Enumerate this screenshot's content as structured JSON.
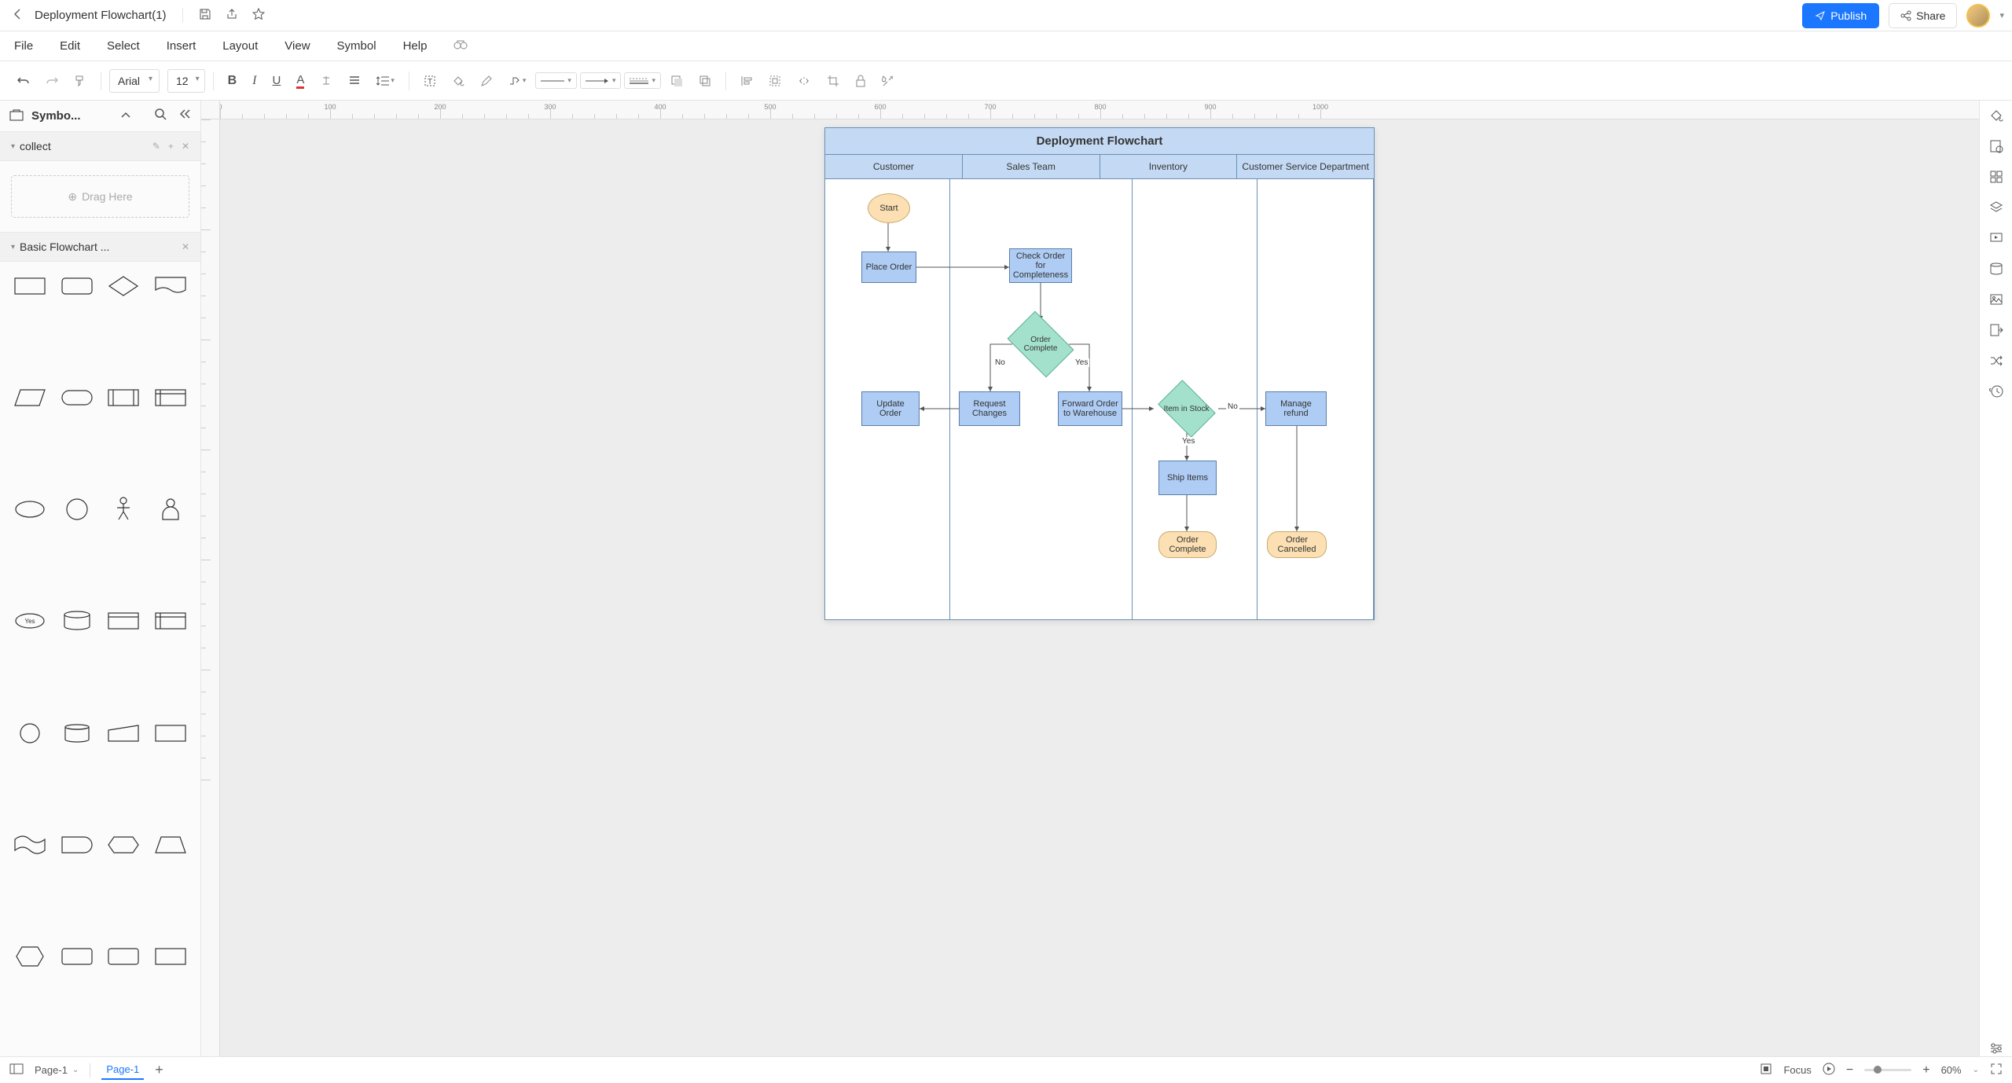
{
  "document": {
    "title": "Deployment Flowchart(1)"
  },
  "topbar": {
    "publish": "Publish",
    "share": "Share"
  },
  "menus": {
    "file": "File",
    "edit": "Edit",
    "select": "Select",
    "insert": "Insert",
    "layout": "Layout",
    "view": "View",
    "symbol": "Symbol",
    "help": "Help"
  },
  "toolbar": {
    "font": "Arial",
    "size": "12"
  },
  "sidebar": {
    "title": "Symbo...",
    "collect": {
      "label": "collect",
      "drag": "Drag Here"
    },
    "flowchart_section": "Basic Flowchart ..."
  },
  "swimlane": {
    "title": "Deployment Flowchart",
    "columns": [
      "Customer",
      "Sales Team",
      "Inventory",
      "Customer Service Department"
    ]
  },
  "nodes": {
    "start": "Start",
    "place_order": "Place Order",
    "check_order": "Check Order for Completeness",
    "order_complete_d": "Order Complete",
    "no": "No",
    "yes": "Yes",
    "request_changes": "Request Changes",
    "update_order": "Update Order",
    "forward": "Forward Order to Warehouse",
    "item_stock": "Item in Stock",
    "no2": "No",
    "yes2": "Yes",
    "manage_refund": "Manage refund",
    "ship_items": "Ship Items",
    "order_complete_end": "Order Complete",
    "order_cancelled": "Order Cancelled"
  },
  "status": {
    "page_dd": "Page-1",
    "page_tab": "Page-1",
    "focus": "Focus",
    "zoom": "60%"
  },
  "shape_alts": {
    "s1": "rectangle",
    "s2": "rounded-rect",
    "s3": "diamond",
    "s4": "document",
    "s5": "parallelogram",
    "s6": "capsule",
    "s7": "predefined",
    "s8": "internal-storage",
    "s9": "ellipse",
    "s10": "circle",
    "s11": "actor",
    "s12": "person",
    "s13": "yes-badge",
    "s14": "database",
    "s15": "card",
    "s16": "card2",
    "s17": "connector",
    "s18": "cylinder",
    "s19": "manual-input",
    "s20": "display",
    "s21": "tape",
    "s22": "delay",
    "s23": "preparation",
    "s24": "trapezoid",
    "s25": "offpage",
    "s26": "merge",
    "s27": "barrel",
    "s28": "rect"
  }
}
